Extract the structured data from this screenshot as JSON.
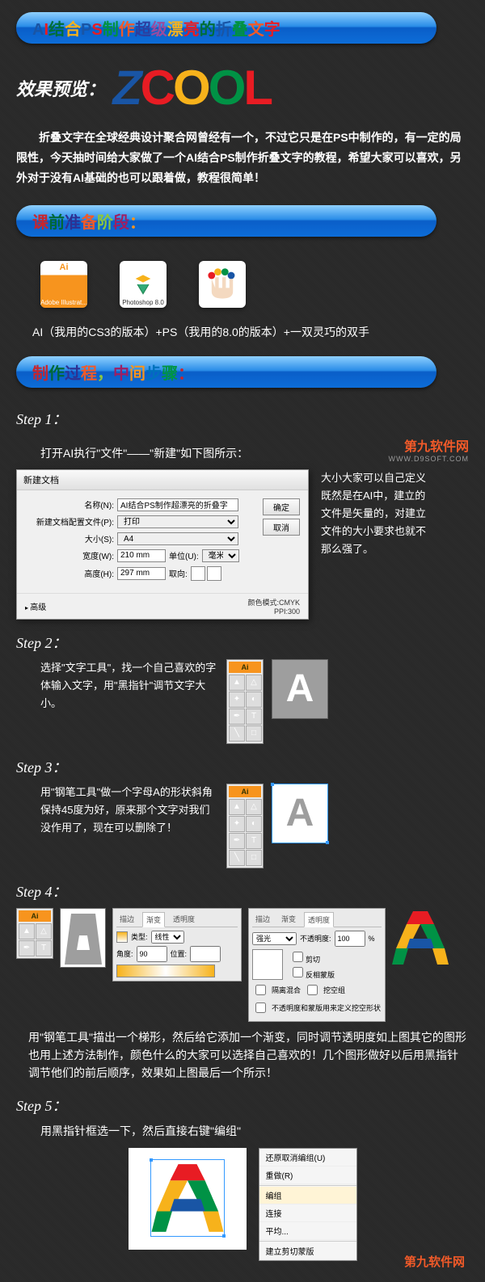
{
  "header": {
    "title_chars": [
      "A",
      "I",
      "结",
      "合",
      "P",
      "S",
      "制",
      "作",
      "超",
      "级",
      "漂",
      "亮",
      "的",
      "折",
      "叠",
      "文",
      "字"
    ]
  },
  "preview": {
    "label": "效果预览：",
    "logo": [
      "Z",
      "C",
      "O",
      "O",
      "L"
    ]
  },
  "intro": "折叠文字在全球经典设计聚合网曾经有一个，不过它只是在PS中制作的，有一定的局限性，今天抽时间给大家做了一个AI结合PS制作折叠文字的教程，希望大家可以喜欢，另外对于没有AI基础的也可以跟着做，教程很简单！",
  "section_prep": {
    "title_chars": [
      "课",
      "前",
      "准",
      "备",
      "阶",
      "段",
      "："
    ]
  },
  "icons": {
    "ai_label": "Adobe Illustrat...",
    "ps_label": "Photoshop 8.0",
    "caption": "AI（我用的CS3的版本）+PS（我用的8.0的版本）+一双灵巧的双手"
  },
  "section_process": {
    "title_chars": [
      "制",
      "作",
      "过",
      "程",
      "，",
      "中",
      "间",
      "步",
      "骤",
      "："
    ]
  },
  "watermark": {
    "main": "第九软件网",
    "sub": "WWW.D9SOFT.COM"
  },
  "steps": {
    "s1": {
      "label": "Step 1：",
      "text": "打开AI执行\"文件\"——\"新建\"如下图所示：",
      "side": "大小大家可以自己定义既然是在AI中，建立的文件是矢量的，对建立文件的大小要求也就不那么强了。"
    },
    "s2": {
      "label": "Step 2：",
      "text": "选择\"文字工具\"，找一个自己喜欢的字体输入文字，用\"黑指针\"调节文字大小。"
    },
    "s3": {
      "label": "Step 3：",
      "text": "用\"钢笔工具\"做一个字母A的形状斜角保持45度为好，原来那个文字对我们没作用了，现在可以删除了！"
    },
    "s4": {
      "label": "Step 4：",
      "text": "用\"钢笔工具\"描出一个梯形，然后给它添加一个渐变，同时调节透明度如上图其它的图形也用上述方法制作，颜色什么的大家可以选择自己喜欢的！几个图形做好以后用黑指针调节他们的前后顺序，效果如上图最后一个所示！"
    },
    "s5": {
      "label": "Step 5：",
      "text": "用黑指针框选一下，然后直接右键\"编组\""
    }
  },
  "dialog": {
    "title": "新建文档",
    "name_label": "名称(N):",
    "name_value": "AI结合PS制作超漂亮的折叠字",
    "profile_label": "新建文档配置文件(P):",
    "profile_value": "打印",
    "size_label": "大小(S):",
    "size_value": "A4",
    "width_label": "宽度(W):",
    "width_value": "210 mm",
    "unit_label": "单位(U):",
    "unit_value": "毫米",
    "height_label": "高度(H):",
    "height_value": "297 mm",
    "orient_label": "取向:",
    "advanced": "高级",
    "ok": "确定",
    "cancel": "取消",
    "color_mode": "颜色模式:CMYK",
    "ppi": "PPI:300"
  },
  "gradient_panel": {
    "tabs": [
      "描边",
      "渐变",
      "透明度"
    ],
    "type_label": "类型:",
    "type_value": "线性",
    "angle_label": "角度:",
    "angle_value": "90",
    "loc_label": "位置:"
  },
  "opacity_panel": {
    "tabs": [
      "描边",
      "渐变",
      "透明度"
    ],
    "mode": "强光",
    "opacity_label": "不透明度:",
    "opacity_value": "100",
    "pct": "%",
    "clip": "剪切",
    "invert": "反相蒙版",
    "isolate": "隔离混合",
    "knockout": "挖空组",
    "shape_note": "不透明度和蒙版用来定义挖空形状"
  },
  "context_menu": {
    "items": [
      "还原取消编组(U)",
      "重做(R)",
      "编组",
      "连接",
      "平均...",
      "建立剪切蒙版"
    ]
  },
  "tool_header": "Ai"
}
